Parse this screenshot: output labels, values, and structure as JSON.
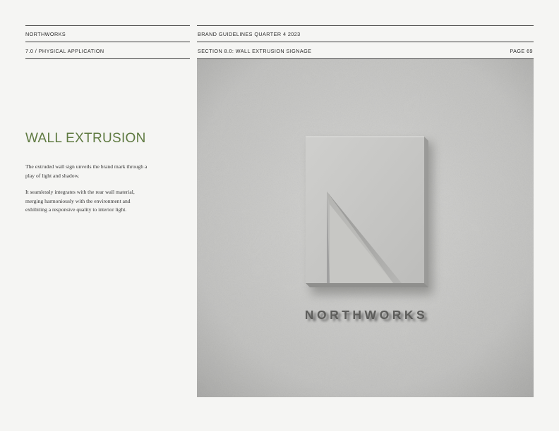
{
  "header": {
    "brand": "NORTHWORKS",
    "doc_title": "BRAND GUIDELINES QUARTER 4 2023",
    "chapter": "7.0 / PHYSICAL APPLICATION",
    "section": "SECTION 8.0: WALL EXTRUSION SIGNAGE",
    "page": "PAGE 69"
  },
  "content": {
    "title": "WALL EXTRUSION",
    "paragraph_1": "The extruded wall sign unveils the brand mark through a play of light and shadow.",
    "paragraph_2": "It seamlessly integrates with the rear wall material, merging harmoniously with the environment and exhibiting a responsive quality to interior light."
  },
  "photo": {
    "sign_wordmark": "NORTHWORKS",
    "sign_letter": "N",
    "wall_color": "#c8c8c6",
    "accent_color": "#5f7a41"
  }
}
